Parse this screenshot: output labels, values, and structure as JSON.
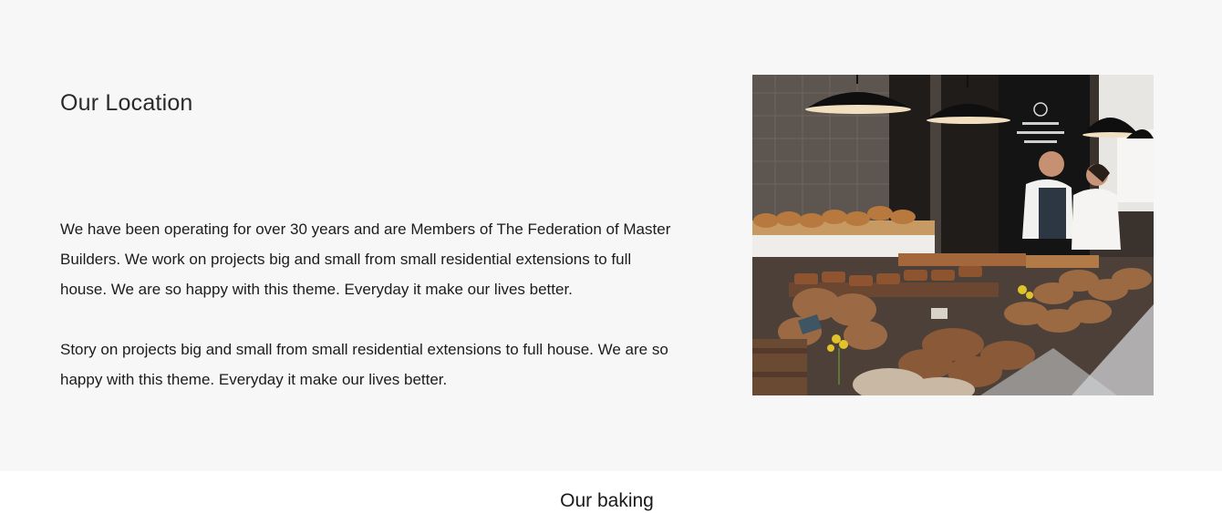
{
  "location": {
    "title": "Our Location",
    "paragraphs": [
      "We have been operating for over 30 years and are Members of The Federation of Master Builders. We work on projects big and small from small residential extensions to full house. We are so happy with this theme. Everyday it make our lives better.",
      "Story on projects big and small from small residential extensions to full house. We are so happy with this theme. Everyday it make our lives better."
    ]
  },
  "next_section": {
    "title": "Our baking"
  }
}
